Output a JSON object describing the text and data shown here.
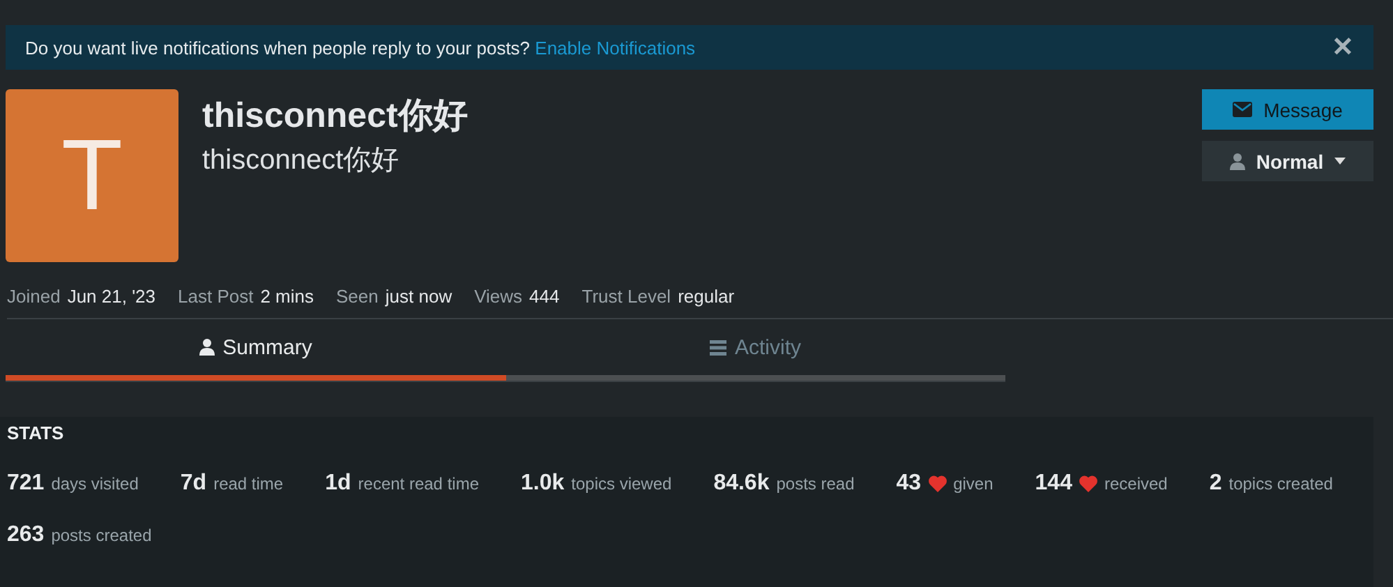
{
  "banner": {
    "text": "Do you want live notifications when people reply to your posts?",
    "link": "Enable Notifications",
    "close": "✕"
  },
  "profile": {
    "avatar_letter": "T",
    "username": "thisconnect你好",
    "full_name": "thisconnect你好"
  },
  "actions": [
    {
      "kind": "message",
      "label": "Message"
    },
    {
      "kind": "dropdown",
      "label": "Normal"
    }
  ],
  "info": [
    {
      "label": "Joined",
      "value": "Jun 21, '23"
    },
    {
      "label": "Last Post",
      "value": "2 mins"
    },
    {
      "label": "Seen",
      "value": "just now"
    },
    {
      "label": "Views",
      "value": "444"
    },
    {
      "label": "Trust Level",
      "value": "regular"
    }
  ],
  "tabs": [
    {
      "label": "Summary",
      "kind": "user",
      "selected": true
    },
    {
      "label": "Activity",
      "kind": "list",
      "selected": false
    }
  ],
  "stats": {
    "title": "STATS",
    "items": [
      {
        "value": "721",
        "label": "days visited",
        "heart": false
      },
      {
        "value": "7d",
        "label": "read time",
        "heart": false
      },
      {
        "value": "1d",
        "label": "recent read time",
        "heart": false
      },
      {
        "value": "1.0k",
        "label": "topics viewed",
        "heart": false
      },
      {
        "value": "84.6k",
        "label": "posts read",
        "heart": false
      },
      {
        "value": "43",
        "label": "given",
        "heart": true
      },
      {
        "value": "144",
        "label": "received",
        "heart": true
      },
      {
        "value": "2",
        "label": "topics created",
        "heart": false
      },
      {
        "value": "263",
        "label": "posts created",
        "heart": false
      }
    ]
  }
}
